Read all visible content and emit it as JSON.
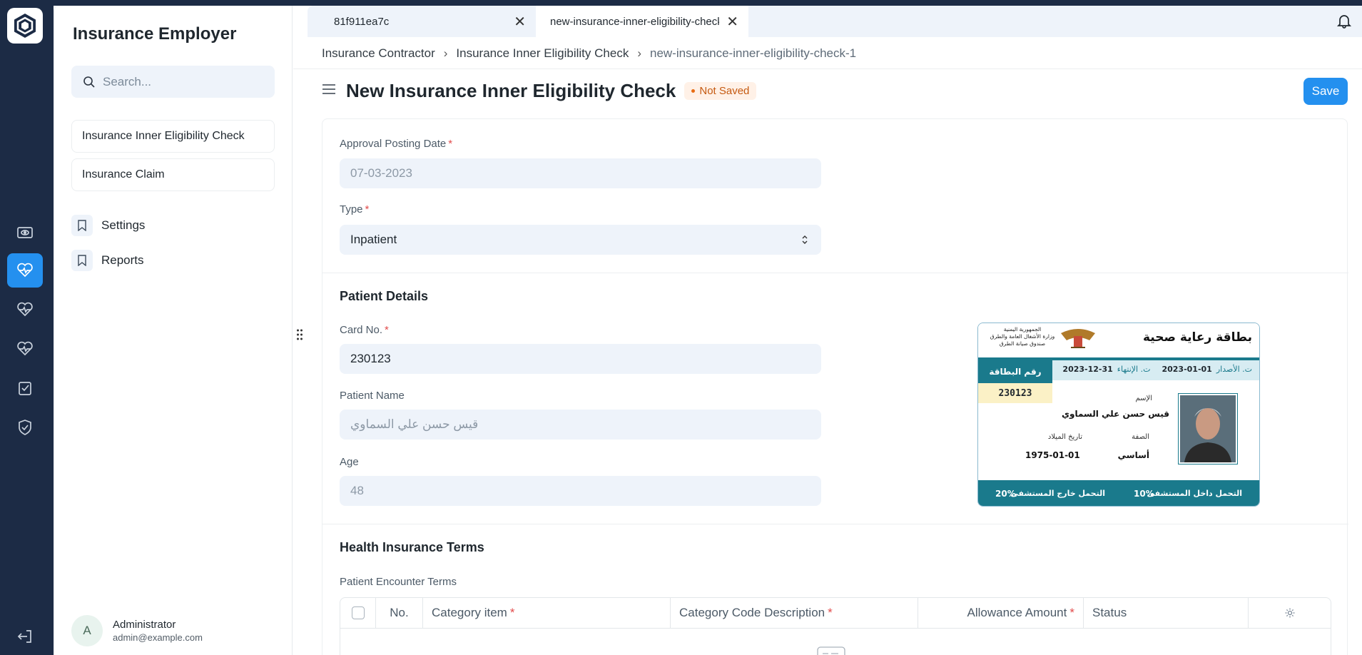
{
  "app": {
    "sidebar_title": "Insurance Employer"
  },
  "search": {
    "placeholder": "Search..."
  },
  "sidebar": {
    "items": [
      {
        "label": "Insurance Inner Eligibility Check"
      },
      {
        "label": "Insurance Claim"
      }
    ],
    "links": [
      {
        "label": "Settings",
        "icon": "bookmark-icon"
      },
      {
        "label": "Reports",
        "icon": "bookmark-icon"
      }
    ]
  },
  "user": {
    "avatar_letter": "A",
    "name": "Administrator",
    "email": "admin@example.com"
  },
  "tabs": [
    {
      "label": "81f911ea7c"
    },
    {
      "label": "new-insurance-inner-eligibility-check"
    }
  ],
  "breadcrumb": [
    "Insurance Contractor",
    "Insurance Inner Eligibility Check",
    "new-insurance-inner-eligibility-check-1"
  ],
  "page": {
    "title": "New Insurance Inner Eligibility Check",
    "status": "Not Saved",
    "save_label": "Save"
  },
  "form": {
    "approval_posting_date": {
      "label": "Approval Posting Date",
      "value": "07-03-2023"
    },
    "type": {
      "label": "Type",
      "value": "Inpatient"
    },
    "patient_section": "Patient Details",
    "card_no": {
      "label": "Card No.",
      "value": "230123"
    },
    "patient_name": {
      "label": "Patient Name",
      "value": "قيس حسن علي السماوي"
    },
    "age": {
      "label": "Age",
      "value": "48"
    },
    "terms_section": "Health Insurance Terms",
    "encounter_terms_label": "Patient Encounter Terms",
    "grid_columns": [
      "No.",
      "Category item",
      "Category Code Description",
      "Allowance Amount",
      "Status"
    ]
  },
  "card": {
    "title": "بطاقة رعاية صحية",
    "issuer_lines": [
      "الجمهورية اليمنية",
      "وزارة الأشغال العامة والطرق",
      "صندوق صيانة الطرق"
    ],
    "issue_label": "ت. الأصدار",
    "issue_date": "2023-01-01",
    "expiry_label": "ت. الإنتهاء",
    "expiry_date": "2023-12-31",
    "card_no_label": "رقم البطاقة",
    "card_no": "230123",
    "name_label": "الإسم",
    "name": "قيس حسن علي السماوي",
    "relation_label": "الصفة",
    "relation": "أساسي",
    "dob_label": "تاريخ الميلاد",
    "dob": "1975-01-01",
    "inpatient_label": "التحمل داخل المستشفى",
    "inpatient_pct": "10%",
    "outpatient_label": "التحمل خارج المستشفى",
    "outpatient_pct": "20%"
  },
  "colors": {
    "primary": "#2490ef",
    "rail": "#1c2b45",
    "card_teal": "#1a7a8c"
  }
}
